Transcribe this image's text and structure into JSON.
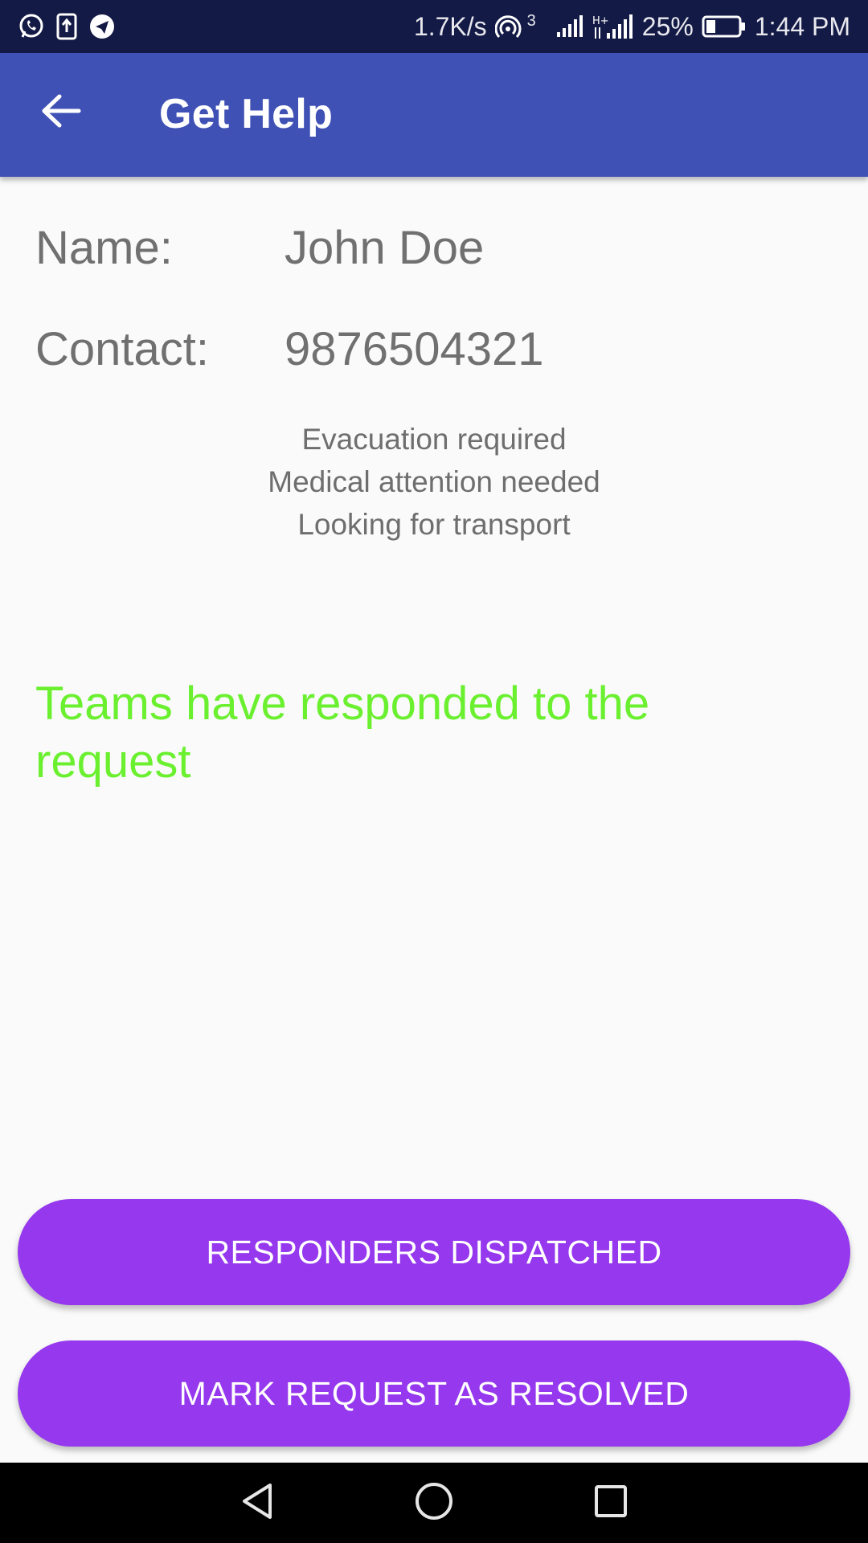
{
  "status_bar": {
    "net_speed": "1.7K/s",
    "battery_percent": "25%",
    "time": "1:44 PM",
    "icons": [
      "whatsapp-icon",
      "upload-icon",
      "telegram-icon",
      "hotspot-icon",
      "signal-icon",
      "signal-icon",
      "battery-icon"
    ],
    "hotspot_count": "3"
  },
  "app_bar": {
    "title": "Get Help",
    "background": "#3f51b5",
    "back_icon": "arrow-back-icon"
  },
  "details": {
    "name_label": "Name:",
    "name_value": "John Doe",
    "contact_label": "Contact:",
    "contact_value": "9876504321"
  },
  "needs": [
    "Evacuation required",
    "Medical attention needed",
    "Looking for transport"
  ],
  "status_message": {
    "text": "Teams have responded to the request",
    "color": "#6bf030"
  },
  "actions": {
    "dispatch_label": "RESPONDERS DISPATCHED",
    "resolve_label": "MARK REQUEST AS RESOLVED",
    "button_color": "#9538ee"
  },
  "nav_bar": {
    "icons": [
      "back-triangle-icon",
      "home-circle-icon",
      "recents-square-icon"
    ]
  }
}
